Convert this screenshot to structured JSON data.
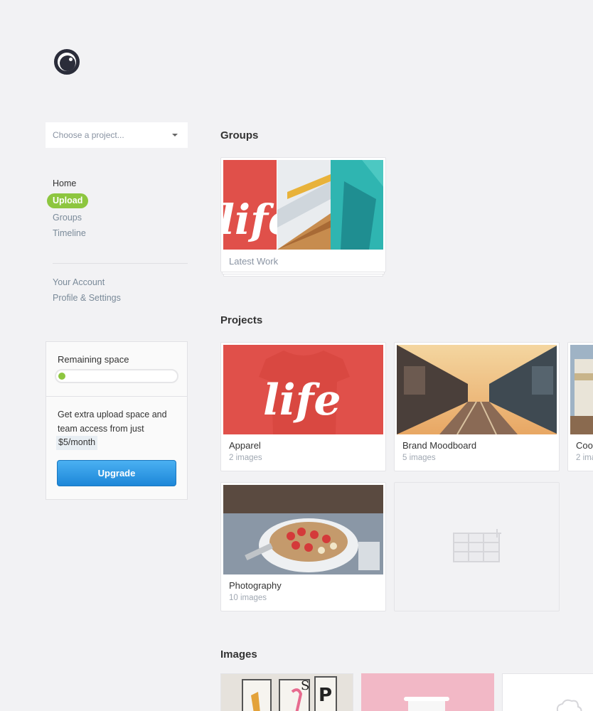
{
  "project_select": {
    "placeholder": "Choose a project..."
  },
  "nav": {
    "primary": [
      "Home",
      "Upload",
      "Groups",
      "Timeline"
    ],
    "account": [
      "Your Account",
      "Profile & Settings"
    ]
  },
  "space": {
    "title": "Remaining space",
    "used_fraction": 0.02,
    "text": "Get extra upload space and team access from just",
    "price": "$5/month",
    "button": "Upgrade"
  },
  "sections": {
    "groups": "Groups",
    "projects": "Projects",
    "images": "Images"
  },
  "groups": [
    {
      "title": "Latest Work"
    }
  ],
  "projects": [
    {
      "title": "Apparel",
      "count": "2 images"
    },
    {
      "title": "Brand Moodboard",
      "count": "5 images"
    },
    {
      "title": "Coo",
      "count": "2 ima"
    },
    {
      "title": "Photography",
      "count": "10 images"
    }
  ],
  "colors": {
    "accent_green": "#8dc63f",
    "button_blue": "#2196e6",
    "life_red": "#e0504a"
  }
}
